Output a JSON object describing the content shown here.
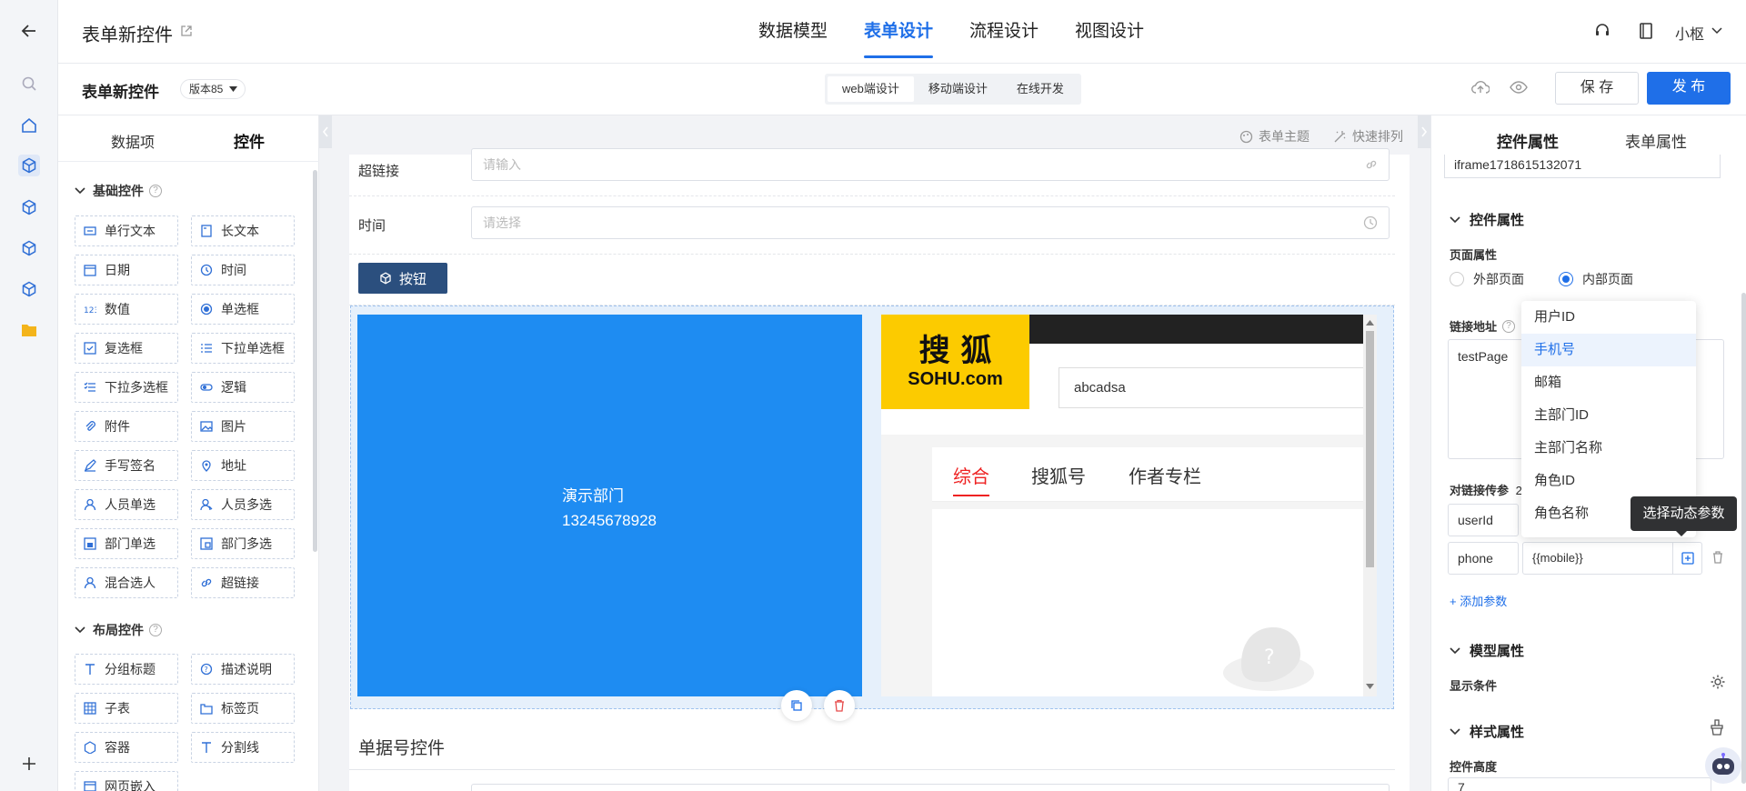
{
  "header": {
    "title": "表单新控件",
    "tabs": [
      "数据模型",
      "表单设计",
      "流程设计",
      "视图设计"
    ],
    "active_tab": 1,
    "user": "小枢"
  },
  "subheader": {
    "form_name": "表单新控件",
    "version": "版本85",
    "modes": [
      "web端设计",
      "移动端设计",
      "在线开发"
    ],
    "save": "保 存",
    "publish": "发 布"
  },
  "left_panel": {
    "tabs": [
      "数据项",
      "控件"
    ],
    "basic_title": "基础控件",
    "basic": [
      "单行文本",
      "长文本",
      "日期",
      "时间",
      "数值",
      "单选框",
      "复选框",
      "下拉单选框",
      "下拉多选框",
      "逻辑",
      "附件",
      "图片",
      "手写签名",
      "地址",
      "人员单选",
      "人员多选",
      "部门单选",
      "部门多选",
      "混合选人",
      "超链接"
    ],
    "layout_title": "布局控件",
    "layout": [
      "分组标题",
      "描述说明",
      "子表",
      "标签页",
      "容器",
      "分割线",
      "网页嵌入"
    ]
  },
  "canvas": {
    "toolbar": {
      "theme": "表单主题",
      "arrange": "快速排列"
    },
    "hyperlink_label": "超链接",
    "hyperlink_placeholder": "请输入",
    "time_label": "时间",
    "time_placeholder": "请选择",
    "button_label": "按钮",
    "card_line1": "演示部门",
    "card_line2": "13245678928",
    "iframe": {
      "logo_top": "搜   狐",
      "logo_bottom": "SOHU.com",
      "search_value": "abcadsa",
      "tabs": [
        "综合",
        "搜狐号",
        "作者专栏"
      ]
    },
    "serial_label": "单据号控件"
  },
  "right_panel": {
    "tabs": [
      "控件属性",
      "表单属性"
    ],
    "id_value": "iframe1718615132071",
    "control_props": "控件属性",
    "page_prop_label": "页面属性",
    "radio_external": "外部页面",
    "radio_internal": "内部页面",
    "link_label": "链接地址",
    "link_value": "testPage",
    "params_label": "对链接传参",
    "params_count": "2",
    "param1_key": "userId",
    "param2_key": "phone",
    "param2_value": "{{mobile}}",
    "add_param": "+ 添加参数",
    "model_props": "模型属性",
    "display_condition": "显示条件",
    "style_props": "样式属性",
    "control_height": "控件高度",
    "height_value": "7"
  },
  "dropdown": {
    "options": [
      "用户ID",
      "手机号",
      "邮箱",
      "主部门ID",
      "主部门名称",
      "角色ID",
      "角色名称"
    ],
    "highlight": 1
  },
  "tooltip": "选择动态参数",
  "colors": {
    "primary": "#1f6fe8",
    "card": "#1e8cf2",
    "button": "#2b4f7e"
  }
}
